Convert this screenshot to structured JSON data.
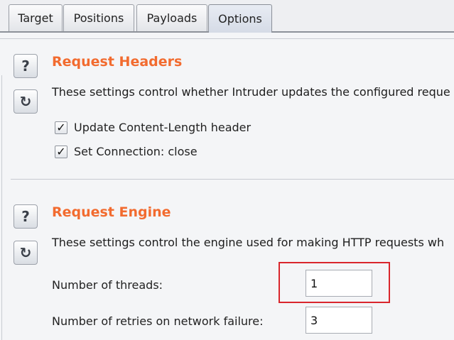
{
  "tabs": [
    {
      "label": "Target"
    },
    {
      "label": "Positions"
    },
    {
      "label": "Payloads"
    },
    {
      "label": "Options"
    }
  ],
  "active_tab": "Options",
  "icons": {
    "help": "?",
    "reset": "↻"
  },
  "request_headers": {
    "title": "Request Headers",
    "description": "These settings control whether Intruder updates the configured reque",
    "options": [
      {
        "label": "Update Content-Length header",
        "checked": true
      },
      {
        "label": "Set Connection: close",
        "checked": true
      }
    ]
  },
  "request_engine": {
    "title": "Request Engine",
    "description": "These settings control the engine used for making HTTP requests wh",
    "fields": [
      {
        "label": "Number of threads:",
        "value": "1"
      },
      {
        "label": "Number of retries on network failure:",
        "value": "3"
      }
    ]
  },
  "colors": {
    "section_title": "#f26b2f",
    "highlight_box": "#d9262c"
  }
}
